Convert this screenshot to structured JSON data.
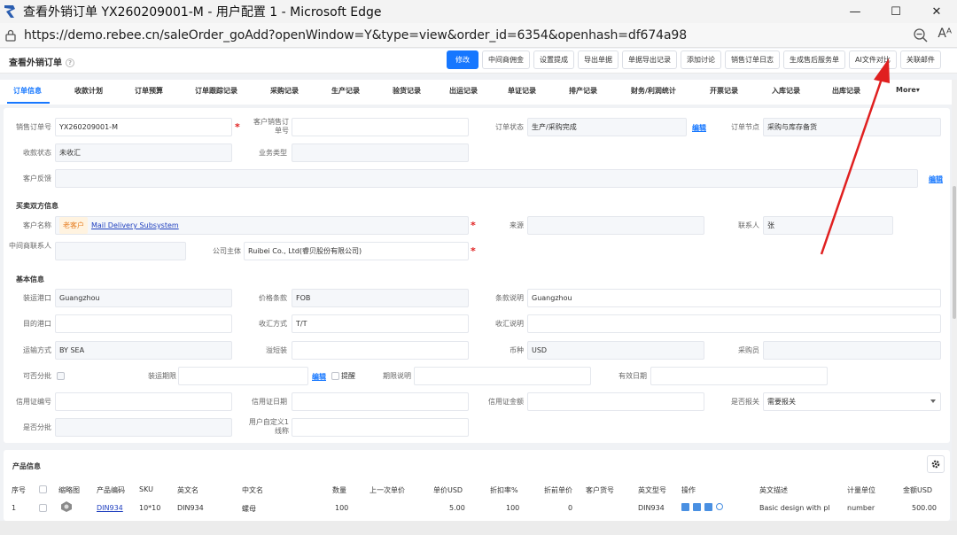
{
  "window": {
    "title": "查看外销订单 YX260209001-M - 用户配置 1 - Microsoft Edge",
    "url": "https://demo.rebee.cn/saleOrder_goAdd?openWindow=Y&type=view&order_id=6354&openhash=df674a98"
  },
  "header": {
    "page_title": "查看外销订单",
    "help_icon": "?"
  },
  "toolbar": {
    "edit": "修改",
    "buttons": [
      "中间商佣金",
      "设置提成",
      "导出单据",
      "单据导出记录",
      "添加讨论",
      "销售订单日志",
      "生成售后服务单",
      "AI文件对比",
      "关联邮件"
    ]
  },
  "tabs": [
    "订单信息",
    "收款计划",
    "订单预算",
    "订单跟踪记录",
    "采购记录",
    "生产记录",
    "验货记录",
    "出运记录",
    "单证记录",
    "排产记录",
    "财务/利润统计",
    "开票记录",
    "入库记录",
    "出库记录",
    "More▾"
  ],
  "form": {
    "sale_order_no_label": "销售订单号",
    "sale_order_no": "YX260209001-M",
    "customer_po_label": "客户销售订单号",
    "customer_po": "",
    "order_status_label": "订单状态",
    "order_status": "生产/采购完成",
    "edit_link": "编辑",
    "order_node_label": "订单节点",
    "order_node": "采购与库存备货",
    "collection_status_label": "收款状态",
    "collection_status": "未收汇",
    "business_type_label": "业务类型",
    "business_type": "",
    "customer_feedback_label": "客户反馈",
    "customer_feedback": "",
    "parties_section": "买卖双方信息",
    "customer_name_label": "客户名称",
    "customer_tag": "老客户",
    "customer_name": "Mail Delivery Subsystem",
    "source_label": "来源",
    "source": "",
    "contact_label": "联系人",
    "contact": "张",
    "middleman_contact_label": "中间商联系人",
    "middleman_contact": "",
    "company_label": "公司主体",
    "company": "Ruibei Co., Ltd(睿贝股份有限公司)",
    "basic_section": "基本信息",
    "port_loading_label": "装运港口",
    "port_loading": "Guangzhou",
    "price_terms_label": "价格条款",
    "price_terms": "FOB",
    "terms_desc_label": "条款说明",
    "terms_desc": "Guangzhou",
    "destination_label": "目的港口",
    "destination": "",
    "payment_method_label": "收汇方式",
    "payment_method": "T/T",
    "payment_desc_label": "收汇说明",
    "payment_desc": "",
    "transport_label": "运输方式",
    "transport": "BY SEA",
    "overflow_label": "溢短装",
    "overflow": "",
    "currency_label": "币种",
    "currency": "USD",
    "purchaser_label": "采购员",
    "purchaser": "",
    "partial_label": "可否分批",
    "ship_date_label": "装运期限",
    "ship_date": "",
    "remind_label": "提醒",
    "deadline_desc_label": "期限说明",
    "deadline_desc": "",
    "valid_date_label": "有效日期",
    "valid_date": "",
    "lc_no_label": "信用证编号",
    "lc_no": "",
    "lc_date_label": "信用证日期",
    "lc_date": "",
    "lc_amount_label": "信用证金额",
    "lc_amount": "",
    "customs_label": "是否报关",
    "customs": "需要报关",
    "split_label": "是否分批",
    "split": "",
    "custom1_label": "用户自定义1线称",
    "custom1": ""
  },
  "products": {
    "section_title": "产品信息",
    "columns": [
      "序号",
      "",
      "缩略图",
      "产品编码",
      "SKU",
      "英文名",
      "中文名",
      "数量",
      "上一次单价",
      "单价USD",
      "折扣率%",
      "折前单价",
      "客户货号",
      "英文型号",
      "操作",
      "英文描述",
      "计量单位",
      "金额USD"
    ],
    "row": [
      "1",
      "",
      "",
      "DIN934",
      "10*10",
      "DIN934",
      "螺母",
      "100",
      "",
      "5.00",
      "100",
      "0",
      "",
      "DIN934",
      "",
      "Basic design with pl",
      "number",
      "500.00"
    ]
  },
  "colors": {
    "primary": "#1677ff",
    "annotation_arrow": "#e02020"
  }
}
